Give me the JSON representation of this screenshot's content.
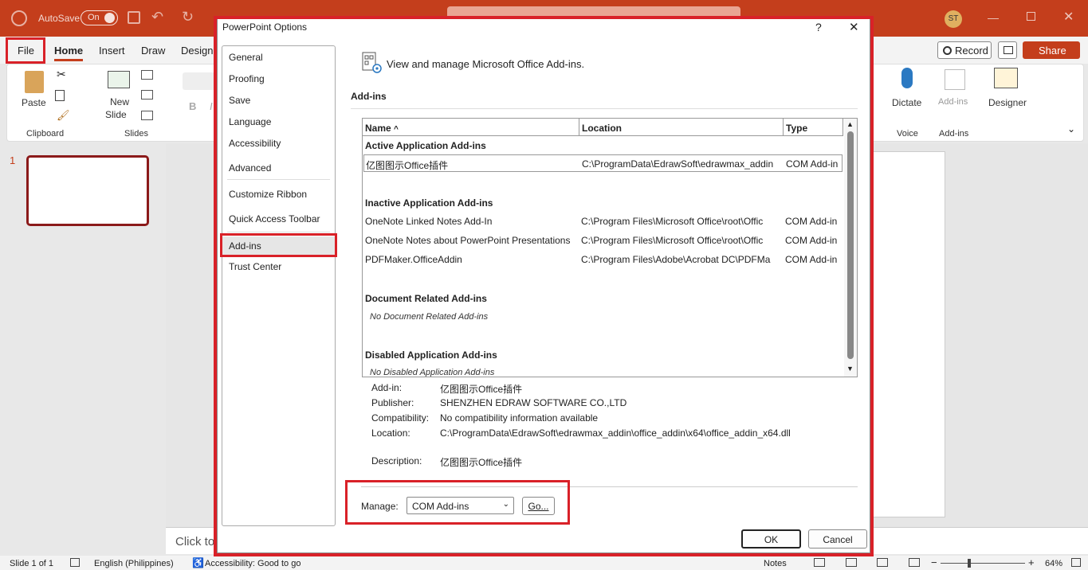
{
  "titlebar": {
    "autosave_label": "AutoSave",
    "autosave_state": "On",
    "user_initials": "ST"
  },
  "ribbon_tabs": [
    "File",
    "Home",
    "Insert",
    "Draw",
    "Design"
  ],
  "ribbon_right": {
    "record_label": "Record",
    "share_label": "Share"
  },
  "ribbon": {
    "paste": "Paste",
    "clipboard": "Clipboard",
    "new_slide": "New",
    "new_slide2": "Slide",
    "slides": "Slides",
    "dictate": "Dictate",
    "voice": "Voice",
    "addins_btn": "Add-ins",
    "addins_group": "Add-ins",
    "designer": "Designer",
    "bold": "B",
    "italic": "I"
  },
  "slide_panel": {
    "slide_number": "1",
    "click_to": "Click to"
  },
  "statusbar": {
    "slide_count": "Slide 1 of 1",
    "language": "English (Philippines)",
    "accessibility": "Accessibility: Good to go",
    "notes": "Notes",
    "zoom": "64%"
  },
  "dialog": {
    "title": "PowerPoint Options",
    "help": "?",
    "close": "✕",
    "nav": [
      "General",
      "Proofing",
      "Save",
      "Language",
      "Accessibility",
      "Advanced",
      "Customize Ribbon",
      "Quick Access Toolbar",
      "Add-ins",
      "Trust Center"
    ],
    "header_text": "View and manage Microsoft Office Add-ins.",
    "section_title": "Add-ins",
    "table": {
      "columns": [
        "Name",
        "Location",
        "Type"
      ],
      "sort_indicator": "^",
      "active_header": "Active Application Add-ins",
      "active": [
        {
          "name": "亿图图示Office插件",
          "location": "C:\\ProgramData\\EdrawSoft\\edrawmax_addin",
          "type": "COM Add-in"
        }
      ],
      "inactive_header": "Inactive Application Add-ins",
      "inactive": [
        {
          "name": "OneNote Linked Notes Add-In",
          "location": "C:\\Program Files\\Microsoft Office\\root\\Offic",
          "type": "COM Add-in"
        },
        {
          "name": "OneNote Notes about PowerPoint Presentations",
          "location": "C:\\Program Files\\Microsoft Office\\root\\Offic",
          "type": "COM Add-in"
        },
        {
          "name": "PDFMaker.OfficeAddin",
          "location": "C:\\Program Files\\Adobe\\Acrobat DC\\PDFMa",
          "type": "COM Add-in"
        }
      ],
      "document_header": "Document Related Add-ins",
      "document_empty": "No Document Related Add-ins",
      "disabled_header": "Disabled Application Add-ins",
      "disabled_empty": "No Disabled Application Add-ins"
    },
    "details": {
      "addin_label": "Add-in:",
      "addin_value": "亿图图示Office插件",
      "publisher_label": "Publisher:",
      "publisher_value": "SHENZHEN EDRAW SOFTWARE CO.,LTD",
      "compat_label": "Compatibility:",
      "compat_value": "No compatibility information available",
      "location_label": "Location:",
      "location_value": "C:\\ProgramData\\EdrawSoft\\edrawmax_addin\\office_addin\\x64\\office_addin_x64.dll",
      "desc_label": "Description:",
      "desc_value": "亿图图示Office插件"
    },
    "manage": {
      "label": "Manage:",
      "selected": "COM Add-ins",
      "go": "Go..."
    },
    "ok": "OK",
    "cancel": "Cancel"
  },
  "colors": {
    "accent": "#c43e1c",
    "highlight": "#d92128"
  }
}
